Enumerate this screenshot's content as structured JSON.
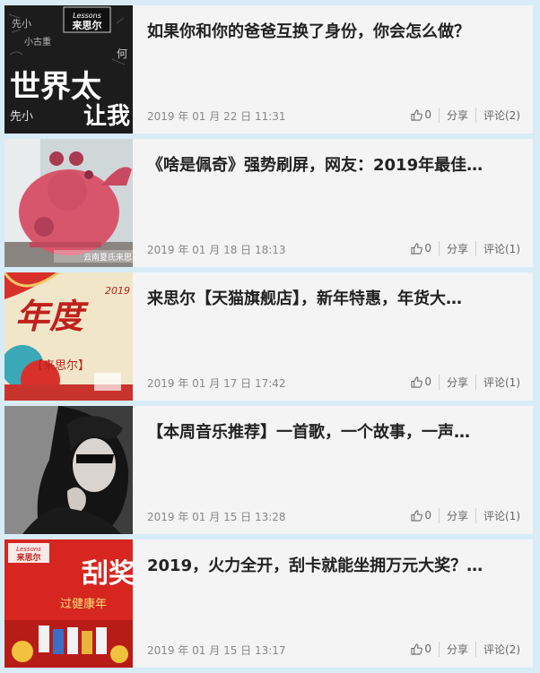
{
  "articles": [
    {
      "title": "如果你和你的爸爸互换了身份，你会怎么做？",
      "date": "2019 年 01 月 22 日 11:31",
      "likes": "0",
      "share": "分享",
      "comments": "评论(2)",
      "thumb_text": [
        "世界太",
        "让我"
      ],
      "thumb_brand": "Lessons 来思尔"
    },
    {
      "title": "《啥是佩奇》强势刷屏，网友：2019年最佳…",
      "date": "2019 年 01 月 18 日 18:13",
      "likes": "0",
      "share": "分享",
      "comments": "评论(1)",
      "thumb_watermark": "云南夏氏来思"
    },
    {
      "title": "来思尔【天猫旗舰店】，新年特惠，年货大…",
      "date": "2019 年 01 月 17 日 17:42",
      "likes": "0",
      "share": "分享",
      "comments": "评论(1)",
      "thumb_text": [
        "年度",
        "【来思尔】",
        "2019"
      ]
    },
    {
      "title": "【本周音乐推荐】一首歌，一个故事，一声…",
      "date": "2019 年 01 月 15 日 13:28",
      "likes": "0",
      "share": "分享",
      "comments": "评论(1)"
    },
    {
      "title": "2019，火力全开，刮卡就能坐拥万元大奖？…",
      "date": "2019 年 01 月 15 日 13:17",
      "likes": "0",
      "share": "分享",
      "comments": "评论(2)",
      "thumb_text": [
        "刮奖",
        "过健康年"
      ],
      "thumb_brand": "Lessons 来思尔"
    }
  ],
  "colors": {
    "background": "#d8ecf7",
    "card": "#f4f4f4"
  },
  "icons": [
    "thumbs-up-icon"
  ]
}
